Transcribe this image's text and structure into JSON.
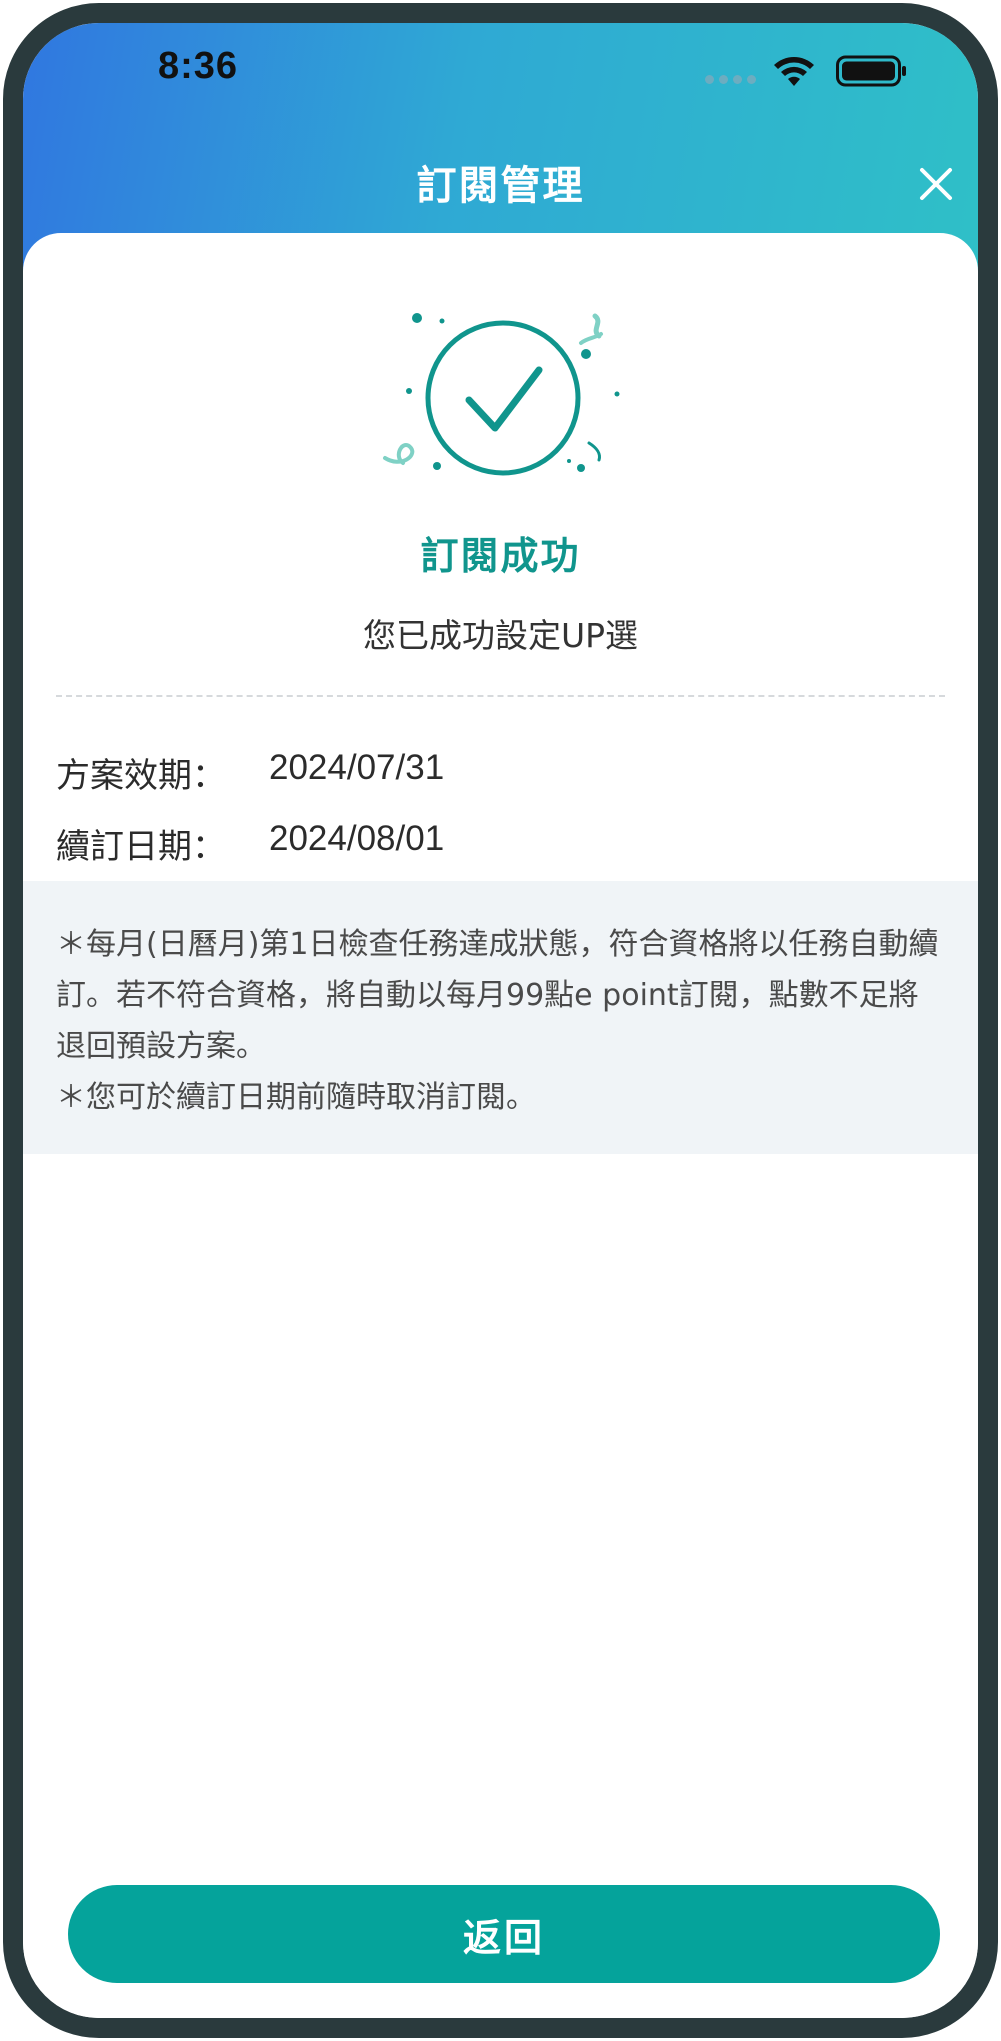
{
  "status_bar": {
    "time": "8:36"
  },
  "header": {
    "title": "訂閱管理",
    "close_icon": "close-icon"
  },
  "success": {
    "title": "訂閱成功",
    "message": "您已成功設定UP選",
    "icon": "check-circle-icon"
  },
  "details": [
    {
      "label": "方案效期：",
      "value": "2024/07/31"
    },
    {
      "label": "續訂日期：",
      "value": "2024/08/01"
    }
  ],
  "notes": [
    "＊每月(日曆月)第1日檢查任務達成狀態，符合資格將以任務自動續訂。若不符合資格，將自動以每月99點e point訂閱，點數不足將退回預設方案。",
    "＊您可於續訂日期前隨時取消訂閱。"
  ],
  "actions": {
    "return_label": "返回"
  },
  "colors": {
    "accent": "#05a39b",
    "title_green": "#10958d",
    "header_gradient_start": "#3077e0",
    "header_gradient_end": "#2fc0c7",
    "notes_bg": "#f0f4f7",
    "frame": "#2a3a3d"
  }
}
